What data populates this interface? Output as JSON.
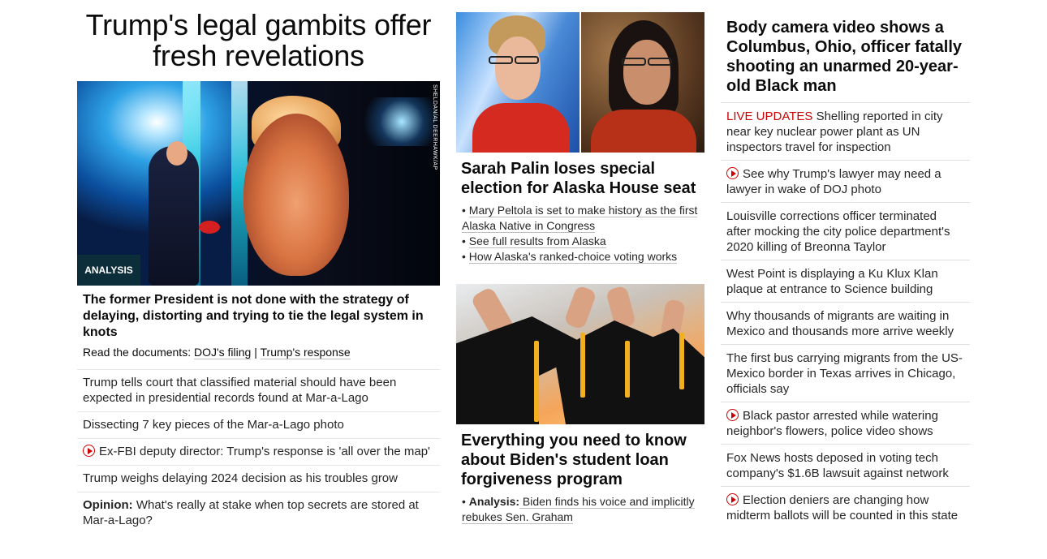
{
  "col1": {
    "headline": "Trump's legal gambits offer fresh revelations",
    "image_credit": "SHELDAN/AL DEERHAWK/AP",
    "badge": "ANALYSIS",
    "description": "The former President is not done with the strategy of delaying, distorting and trying to tie the legal system in knots",
    "read_docs": {
      "prefix": "Read the documents: ",
      "link1": "DOJ's filing",
      "sep": " | ",
      "link2": "Trump's response"
    },
    "items": [
      {
        "text": "Trump tells court that classified material should have been expected in presidential records found at Mar-a-Lago"
      },
      {
        "text": "Dissecting 7 key pieces of the Mar-a-Lago photo"
      },
      {
        "text": "Ex-FBI deputy director: Trump's response is 'all over the map'",
        "icon": "play-icon"
      },
      {
        "text": "Trump weighs delaying 2024 decision as his troubles grow"
      },
      {
        "prefix": "Opinion:",
        "text": " What's really at stake when top secrets are stored at Mar-a-Lago?"
      }
    ]
  },
  "col2": {
    "palin_title": "Sarah Palin loses special election for Alaska House seat",
    "palin_bullets": [
      "Mary Peltola is set to make history as the first Alaska Native in Congress",
      "See full results from Alaska",
      "How Alaska's ranked-choice voting works"
    ],
    "loan_title": "Everything you need to know about Biden's student loan forgiveness program",
    "loan_bullet": {
      "prefix": "Analysis:",
      "text": " Biden finds his voice and implicitly rebukes Sen. Graham"
    }
  },
  "col3": {
    "headline": "Body camera video shows a Columbus, Ohio, officer fatally shooting an unarmed 20-year-old Black man",
    "items": [
      {
        "live": "LIVE UPDATES",
        "text": " Shelling reported in city near key nuclear power plant as UN inspectors travel for inspection"
      },
      {
        "text": "See why Trump's lawyer may need a lawyer in wake of DOJ photo",
        "icon": "play-icon"
      },
      {
        "text": "Louisville corrections officer terminated after mocking the city police department's 2020 killing of Breonna Taylor"
      },
      {
        "text": "West Point is displaying a Ku Klux Klan plaque at entrance to Science building"
      },
      {
        "text": "Why thousands of migrants are waiting in Mexico and thousands more arrive weekly"
      },
      {
        "text": "The first bus carrying migrants from the US-Mexico border in Texas arrives in Chicago, officials say"
      },
      {
        "text": "Black pastor arrested while watering neighbor's flowers, police video shows",
        "icon": "play-icon"
      },
      {
        "text": "Fox News hosts deposed in voting tech company's $1.6B lawsuit against network"
      },
      {
        "text": "Election deniers are changing how midterm ballots will be counted in this state",
        "icon": "play-icon"
      }
    ]
  },
  "colors": {
    "text": "#0c0c0c",
    "live_red": "#cc0000",
    "badge_bg": "#0c2d3a",
    "divider": "#e0e0e0"
  }
}
